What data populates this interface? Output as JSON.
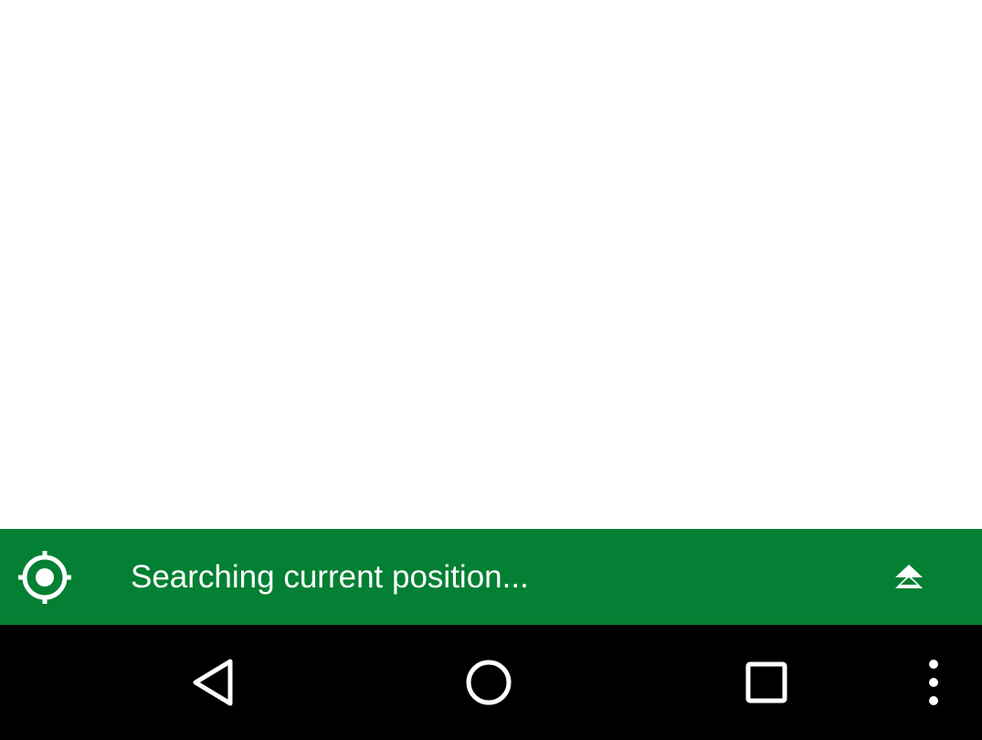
{
  "status": {
    "message": "Searching current position...",
    "background_color": "#038033",
    "text_color": "#ffffff"
  },
  "icons": {
    "locate": "my-location-icon",
    "expand": "double-chevron-up-icon",
    "back": "back-triangle-icon",
    "home": "home-circle-icon",
    "recents": "recents-square-icon",
    "menu": "overflow-menu-icon"
  },
  "nav_bar": {
    "background_color": "#000000",
    "icon_color": "#ffffff"
  }
}
